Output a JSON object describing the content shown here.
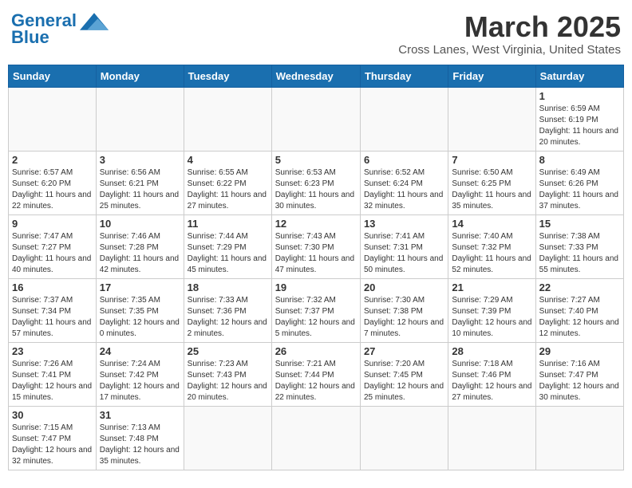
{
  "header": {
    "logo_line1": "General",
    "logo_line2": "Blue",
    "month_title": "March 2025",
    "location": "Cross Lanes, West Virginia, United States"
  },
  "weekdays": [
    "Sunday",
    "Monday",
    "Tuesday",
    "Wednesday",
    "Thursday",
    "Friday",
    "Saturday"
  ],
  "weeks": [
    [
      {
        "day": "",
        "info": ""
      },
      {
        "day": "",
        "info": ""
      },
      {
        "day": "",
        "info": ""
      },
      {
        "day": "",
        "info": ""
      },
      {
        "day": "",
        "info": ""
      },
      {
        "day": "",
        "info": ""
      },
      {
        "day": "1",
        "info": "Sunrise: 6:59 AM\nSunset: 6:19 PM\nDaylight: 11 hours and 20 minutes."
      }
    ],
    [
      {
        "day": "2",
        "info": "Sunrise: 6:57 AM\nSunset: 6:20 PM\nDaylight: 11 hours and 22 minutes."
      },
      {
        "day": "3",
        "info": "Sunrise: 6:56 AM\nSunset: 6:21 PM\nDaylight: 11 hours and 25 minutes."
      },
      {
        "day": "4",
        "info": "Sunrise: 6:55 AM\nSunset: 6:22 PM\nDaylight: 11 hours and 27 minutes."
      },
      {
        "day": "5",
        "info": "Sunrise: 6:53 AM\nSunset: 6:23 PM\nDaylight: 11 hours and 30 minutes."
      },
      {
        "day": "6",
        "info": "Sunrise: 6:52 AM\nSunset: 6:24 PM\nDaylight: 11 hours and 32 minutes."
      },
      {
        "day": "7",
        "info": "Sunrise: 6:50 AM\nSunset: 6:25 PM\nDaylight: 11 hours and 35 minutes."
      },
      {
        "day": "8",
        "info": "Sunrise: 6:49 AM\nSunset: 6:26 PM\nDaylight: 11 hours and 37 minutes."
      }
    ],
    [
      {
        "day": "9",
        "info": "Sunrise: 7:47 AM\nSunset: 7:27 PM\nDaylight: 11 hours and 40 minutes."
      },
      {
        "day": "10",
        "info": "Sunrise: 7:46 AM\nSunset: 7:28 PM\nDaylight: 11 hours and 42 minutes."
      },
      {
        "day": "11",
        "info": "Sunrise: 7:44 AM\nSunset: 7:29 PM\nDaylight: 11 hours and 45 minutes."
      },
      {
        "day": "12",
        "info": "Sunrise: 7:43 AM\nSunset: 7:30 PM\nDaylight: 11 hours and 47 minutes."
      },
      {
        "day": "13",
        "info": "Sunrise: 7:41 AM\nSunset: 7:31 PM\nDaylight: 11 hours and 50 minutes."
      },
      {
        "day": "14",
        "info": "Sunrise: 7:40 AM\nSunset: 7:32 PM\nDaylight: 11 hours and 52 minutes."
      },
      {
        "day": "15",
        "info": "Sunrise: 7:38 AM\nSunset: 7:33 PM\nDaylight: 11 hours and 55 minutes."
      }
    ],
    [
      {
        "day": "16",
        "info": "Sunrise: 7:37 AM\nSunset: 7:34 PM\nDaylight: 11 hours and 57 minutes."
      },
      {
        "day": "17",
        "info": "Sunrise: 7:35 AM\nSunset: 7:35 PM\nDaylight: 12 hours and 0 minutes."
      },
      {
        "day": "18",
        "info": "Sunrise: 7:33 AM\nSunset: 7:36 PM\nDaylight: 12 hours and 2 minutes."
      },
      {
        "day": "19",
        "info": "Sunrise: 7:32 AM\nSunset: 7:37 PM\nDaylight: 12 hours and 5 minutes."
      },
      {
        "day": "20",
        "info": "Sunrise: 7:30 AM\nSunset: 7:38 PM\nDaylight: 12 hours and 7 minutes."
      },
      {
        "day": "21",
        "info": "Sunrise: 7:29 AM\nSunset: 7:39 PM\nDaylight: 12 hours and 10 minutes."
      },
      {
        "day": "22",
        "info": "Sunrise: 7:27 AM\nSunset: 7:40 PM\nDaylight: 12 hours and 12 minutes."
      }
    ],
    [
      {
        "day": "23",
        "info": "Sunrise: 7:26 AM\nSunset: 7:41 PM\nDaylight: 12 hours and 15 minutes."
      },
      {
        "day": "24",
        "info": "Sunrise: 7:24 AM\nSunset: 7:42 PM\nDaylight: 12 hours and 17 minutes."
      },
      {
        "day": "25",
        "info": "Sunrise: 7:23 AM\nSunset: 7:43 PM\nDaylight: 12 hours and 20 minutes."
      },
      {
        "day": "26",
        "info": "Sunrise: 7:21 AM\nSunset: 7:44 PM\nDaylight: 12 hours and 22 minutes."
      },
      {
        "day": "27",
        "info": "Sunrise: 7:20 AM\nSunset: 7:45 PM\nDaylight: 12 hours and 25 minutes."
      },
      {
        "day": "28",
        "info": "Sunrise: 7:18 AM\nSunset: 7:46 PM\nDaylight: 12 hours and 27 minutes."
      },
      {
        "day": "29",
        "info": "Sunrise: 7:16 AM\nSunset: 7:47 PM\nDaylight: 12 hours and 30 minutes."
      }
    ],
    [
      {
        "day": "30",
        "info": "Sunrise: 7:15 AM\nSunset: 7:47 PM\nDaylight: 12 hours and 32 minutes."
      },
      {
        "day": "31",
        "info": "Sunrise: 7:13 AM\nSunset: 7:48 PM\nDaylight: 12 hours and 35 minutes."
      },
      {
        "day": "",
        "info": ""
      },
      {
        "day": "",
        "info": ""
      },
      {
        "day": "",
        "info": ""
      },
      {
        "day": "",
        "info": ""
      },
      {
        "day": "",
        "info": ""
      }
    ]
  ]
}
